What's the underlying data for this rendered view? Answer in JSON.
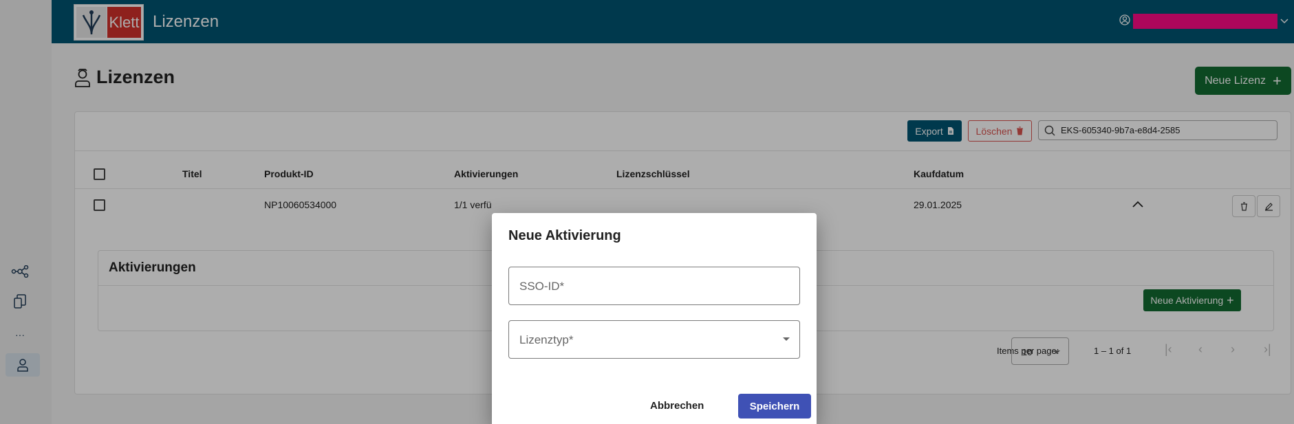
{
  "header": {
    "app_title": "Lizenzen",
    "logo_text": "Klett"
  },
  "page": {
    "title": "Lizenzen",
    "new_license_label": "Neue Lizenz"
  },
  "toolbar": {
    "export_label": "Export",
    "delete_label": "Löschen",
    "search_value": "EKS-605340-9b7a-e8d4-2585"
  },
  "table": {
    "columns": [
      "Titel",
      "Produkt-ID",
      "Aktivierungen",
      "Lizenzschlüssel",
      "Kaufdatum"
    ],
    "rows": [
      {
        "title": "",
        "product_id": "NP10060534000",
        "activations": "1/1 verfü",
        "license_key": "",
        "purchase_date": "29.01.2025"
      }
    ]
  },
  "activations": {
    "title": "Aktivierungen",
    "new_button_label": "Neue Aktivierung"
  },
  "pagination": {
    "items_per_page_label": "Items per page:",
    "page_size": "10",
    "range": "1 – 1 of 1"
  },
  "dialog": {
    "title": "Neue Aktivierung",
    "sso_placeholder": "SSO-ID*",
    "type_placeholder": "Lizenztyp*",
    "cancel_label": "Abbrechen",
    "save_label": "Speichern"
  },
  "colors": {
    "primary": "#005472",
    "success": "#136b32",
    "danger": "#d9534f",
    "dialog_action": "#3f51b5",
    "redaction": "#ff0a86"
  }
}
